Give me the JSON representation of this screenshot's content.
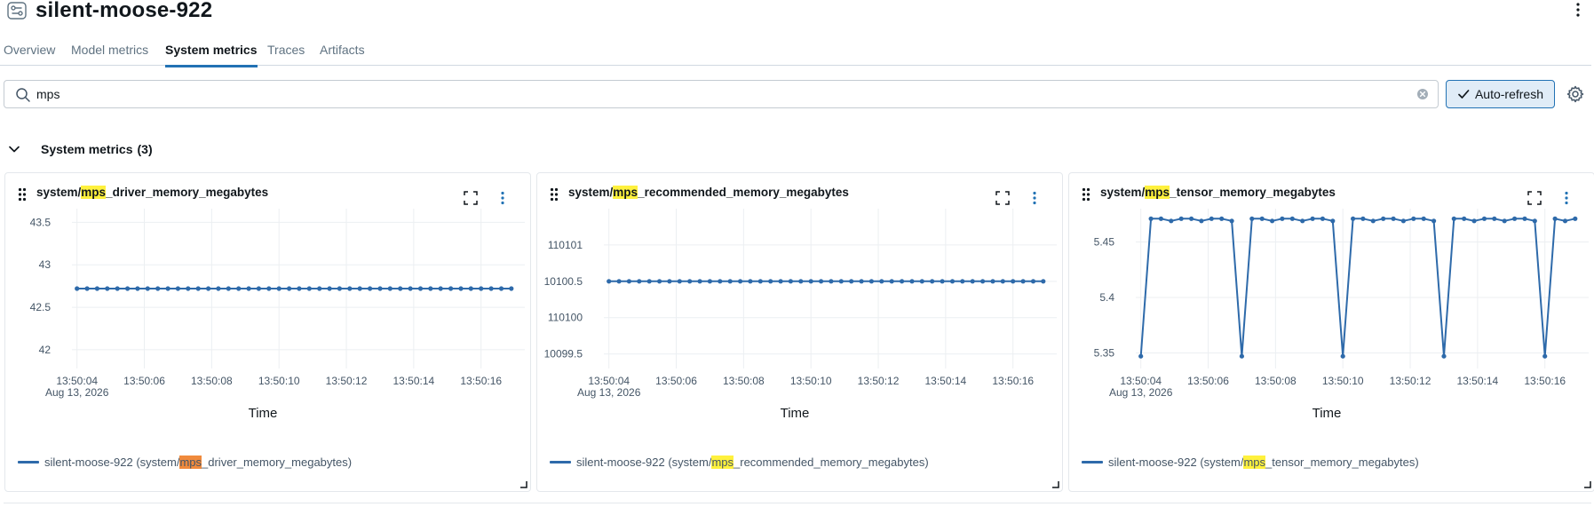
{
  "header": {
    "run_name": "silent-moose-922"
  },
  "tabs": [
    {
      "label": "Overview",
      "active": false
    },
    {
      "label": "Model metrics",
      "active": false
    },
    {
      "label": "System metrics",
      "active": true
    },
    {
      "label": "Traces",
      "active": false
    },
    {
      "label": "Artifacts",
      "active": false
    }
  ],
  "search": {
    "value": "mps",
    "placeholder": ""
  },
  "toolbar": {
    "auto_refresh_label": "Auto-refresh"
  },
  "section": {
    "title": "System metrics",
    "count": "(3)"
  },
  "colors": {
    "accent": "#2272b4",
    "series": "#2e6aaa",
    "highlight": "#fff13d",
    "highlight_active": "#f08a3c"
  },
  "cards": [
    {
      "title_prefix": "system/",
      "title_highlight": "mps",
      "title_suffix": "_driver_memory_megabytes",
      "legend_prefix": "silent-moose-922 (system/",
      "legend_highlight": "mps",
      "legend_suffix": "_driver_memory_megabytes)",
      "legend_highlight_active": true
    },
    {
      "title_prefix": "system/",
      "title_highlight": "mps",
      "title_suffix": "_recommended_memory_megabytes",
      "legend_prefix": "silent-moose-922 (system/",
      "legend_highlight": "mps",
      "legend_suffix": "_recommended_memory_megabytes)",
      "legend_highlight_active": false
    },
    {
      "title_prefix": "system/",
      "title_highlight": "mps",
      "title_suffix": "_tensor_memory_megabytes",
      "legend_prefix": "silent-moose-922 (system/",
      "legend_highlight": "mps",
      "legend_suffix": "_tensor_memory_megabytes)",
      "legend_highlight_active": false
    }
  ],
  "chart_data": [
    {
      "type": "line",
      "title": "system/mps_driver_memory_megabytes",
      "xlabel": "Time",
      "ylabel": "",
      "x_tick_labels": [
        "13:50:04",
        "13:50:06",
        "13:50:08",
        "13:50:10",
        "13:50:12",
        "13:50:14",
        "13:50:16"
      ],
      "x_first_tick_date": "Aug 13, 2026",
      "xlim": [
        3.85,
        17.3
      ],
      "y_ticks": [
        42,
        42.5,
        43,
        43.5
      ],
      "y_tick_labels": [
        "42",
        "42.5",
        "43",
        "43.5"
      ],
      "ylim": [
        41.78,
        43.66
      ],
      "grid": true,
      "series": [
        {
          "name": "silent-moose-922 (system/mps_driver_memory_megabytes)",
          "x": [
            4.0,
            4.3,
            4.6,
            4.9,
            5.2,
            5.5,
            5.8,
            6.1,
            6.4,
            6.7,
            7.0,
            7.3,
            7.6,
            7.9,
            8.2,
            8.5,
            8.8,
            9.1,
            9.4,
            9.7,
            10.0,
            10.3,
            10.6,
            10.9,
            11.2,
            11.5,
            11.8,
            12.1,
            12.4,
            12.7,
            13.0,
            13.3,
            13.6,
            13.9,
            14.2,
            14.5,
            14.8,
            15.1,
            15.4,
            15.7,
            16.0,
            16.3,
            16.6,
            16.9
          ],
          "y": [
            42.72,
            42.72,
            42.72,
            42.72,
            42.72,
            42.72,
            42.72,
            42.72,
            42.72,
            42.72,
            42.72,
            42.72,
            42.72,
            42.72,
            42.72,
            42.72,
            42.72,
            42.72,
            42.72,
            42.72,
            42.72,
            42.72,
            42.72,
            42.72,
            42.72,
            42.72,
            42.72,
            42.72,
            42.72,
            42.72,
            42.72,
            42.72,
            42.72,
            42.72,
            42.72,
            42.72,
            42.72,
            42.72,
            42.72,
            42.72,
            42.72,
            42.72,
            42.72,
            42.72
          ]
        }
      ]
    },
    {
      "type": "line",
      "title": "system/mps_recommended_memory_megabytes",
      "xlabel": "Time",
      "ylabel": "",
      "x_tick_labels": [
        "13:50:04",
        "13:50:06",
        "13:50:08",
        "13:50:10",
        "13:50:12",
        "13:50:14",
        "13:50:16"
      ],
      "x_first_tick_date": "Aug 13, 2026",
      "xlim": [
        3.85,
        17.3
      ],
      "y_ticks": [
        110099.5,
        110100,
        110100.5,
        110101
      ],
      "y_tick_labels": [
        "10099.5",
        "110100",
        "10100.5",
        "110101"
      ],
      "ylim": [
        110099.3,
        110101.5
      ],
      "grid": true,
      "series": [
        {
          "name": "silent-moose-922 (system/mps_recommended_memory_megabytes)",
          "x": [
            4.0,
            4.3,
            4.6,
            4.9,
            5.2,
            5.5,
            5.8,
            6.1,
            6.4,
            6.7,
            7.0,
            7.3,
            7.6,
            7.9,
            8.2,
            8.5,
            8.8,
            9.1,
            9.4,
            9.7,
            10.0,
            10.3,
            10.6,
            10.9,
            11.2,
            11.5,
            11.8,
            12.1,
            12.4,
            12.7,
            13.0,
            13.3,
            13.6,
            13.9,
            14.2,
            14.5,
            14.8,
            15.1,
            15.4,
            15.7,
            16.0,
            16.3,
            16.6,
            16.9
          ],
          "y": [
            110100.5,
            110100.5,
            110100.5,
            110100.5,
            110100.5,
            110100.5,
            110100.5,
            110100.5,
            110100.5,
            110100.5,
            110100.5,
            110100.5,
            110100.5,
            110100.5,
            110100.5,
            110100.5,
            110100.5,
            110100.5,
            110100.5,
            110100.5,
            110100.5,
            110100.5,
            110100.5,
            110100.5,
            110100.5,
            110100.5,
            110100.5,
            110100.5,
            110100.5,
            110100.5,
            110100.5,
            110100.5,
            110100.5,
            110100.5,
            110100.5,
            110100.5,
            110100.5,
            110100.5,
            110100.5,
            110100.5,
            110100.5,
            110100.5,
            110100.5,
            110100.5
          ]
        }
      ]
    },
    {
      "type": "line",
      "title": "system/mps_tensor_memory_megabytes",
      "xlabel": "Time",
      "ylabel": "",
      "x_tick_labels": [
        "13:50:04",
        "13:50:06",
        "13:50:08",
        "13:50:10",
        "13:50:12",
        "13:50:14",
        "13:50:16"
      ],
      "x_first_tick_date": "Aug 13, 2026",
      "xlim": [
        3.85,
        17.3
      ],
      "y_ticks": [
        5.35,
        5.4,
        5.45
      ],
      "y_tick_labels": [
        "5.35",
        "5.4",
        "5.45"
      ],
      "ylim": [
        5.336,
        5.48
      ],
      "grid": true,
      "series": [
        {
          "name": "silent-moose-922 (system/mps_tensor_memory_megabytes)",
          "x": [
            4.0,
            4.3,
            4.6,
            4.9,
            5.2,
            5.5,
            5.8,
            6.1,
            6.4,
            6.7,
            7.0,
            7.3,
            7.6,
            7.9,
            8.2,
            8.5,
            8.8,
            9.1,
            9.4,
            9.7,
            10.0,
            10.3,
            10.6,
            10.9,
            11.2,
            11.5,
            11.8,
            12.1,
            12.4,
            12.7,
            13.0,
            13.3,
            13.6,
            13.9,
            14.2,
            14.5,
            14.8,
            15.1,
            15.4,
            15.7,
            16.0,
            16.3,
            16.6,
            16.9
          ],
          "y": [
            5.347,
            5.471,
            5.471,
            5.469,
            5.471,
            5.471,
            5.469,
            5.471,
            5.471,
            5.469,
            5.347,
            5.471,
            5.471,
            5.469,
            5.471,
            5.471,
            5.469,
            5.471,
            5.471,
            5.469,
            5.347,
            5.471,
            5.471,
            5.469,
            5.471,
            5.471,
            5.469,
            5.471,
            5.471,
            5.469,
            5.347,
            5.471,
            5.471,
            5.469,
            5.471,
            5.471,
            5.469,
            5.471,
            5.471,
            5.469,
            5.347,
            5.471,
            5.469,
            5.471
          ]
        }
      ]
    }
  ]
}
